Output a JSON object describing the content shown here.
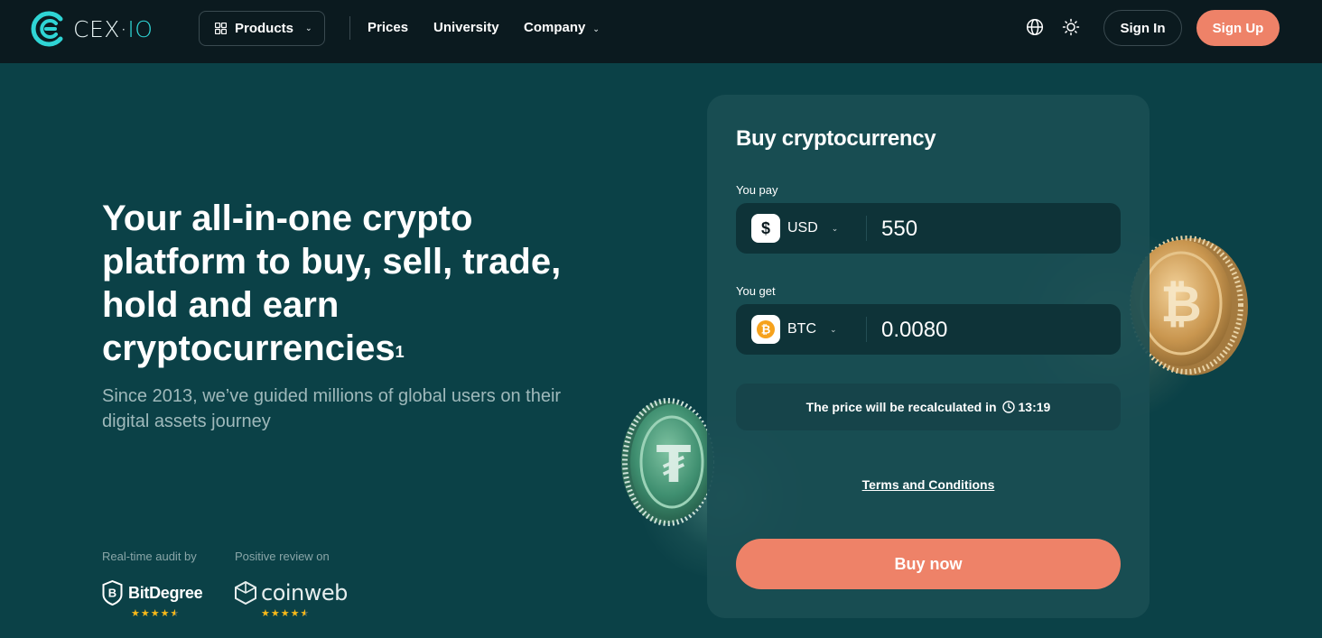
{
  "nav": {
    "logo_main": "CEX",
    "logo_io": "IO",
    "products_label": "Products",
    "links": [
      {
        "label": "Prices"
      },
      {
        "label": "University"
      },
      {
        "label": "Company"
      }
    ],
    "language_icon": "globe-icon",
    "theme_icon": "sun-icon",
    "sign_in_label": "Sign In",
    "sign_up_label": "Sign Up"
  },
  "hero": {
    "title": "Your all-in-one crypto platform to buy, sell, trade, hold and earn cryptocurrencies",
    "title_footnote": "1",
    "subtitle": "Since 2013, we’ve guided millions of global users on their digital assets journey",
    "audit_label": "Real-time audit by",
    "audit_brand": "BitDegree",
    "review_label": "Positive review on",
    "review_brand": "coinweb",
    "audit_rating": 4.5,
    "review_rating": 4.5
  },
  "buy_card": {
    "title": "Buy cryptocurrency",
    "pay_label": "You pay",
    "pay_currency": "USD",
    "pay_symbol": "$",
    "pay_amount": "550",
    "get_label": "You get",
    "get_currency": "BTC",
    "get_symbol": "₿",
    "get_amount": "0.0080",
    "recalc_text": "The price will be recalculated in",
    "recalc_time": "13:19",
    "terms_label": "Terms and Conditions",
    "buy_label": "Buy now"
  },
  "colors": {
    "page_bg": "#0b4147",
    "nav_bg": "#0b1a1f",
    "accent": "#ee8268",
    "brand_cyan": "#2fd5d5",
    "star": "#f6b819"
  }
}
